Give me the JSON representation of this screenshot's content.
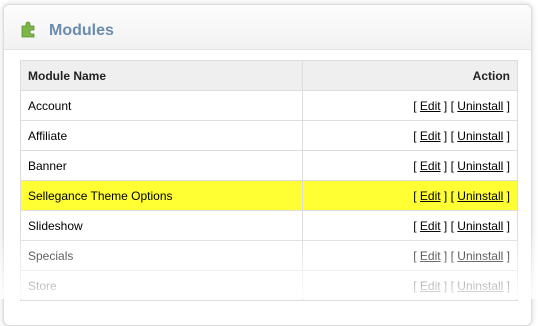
{
  "panel": {
    "title": "Modules",
    "icon": "puzzle-piece-icon",
    "icon_color": "#7ab648",
    "title_color": "#6b8cae"
  },
  "table": {
    "headers": {
      "name": "Module Name",
      "action": "Action"
    },
    "action": {
      "open": "[",
      "edit": "Edit",
      "separator": "] [",
      "uninstall": "Uninstall",
      "close": "]"
    },
    "rows": [
      {
        "name": "Account",
        "highlighted": false
      },
      {
        "name": "Affiliate",
        "highlighted": false
      },
      {
        "name": "Banner",
        "highlighted": false
      },
      {
        "name": "Sellegance Theme Options",
        "highlighted": true
      },
      {
        "name": "Slideshow",
        "highlighted": false
      },
      {
        "name": "Specials",
        "highlighted": false
      },
      {
        "name": "Store",
        "highlighted": false
      }
    ],
    "highlight_color": "#ffff33"
  }
}
